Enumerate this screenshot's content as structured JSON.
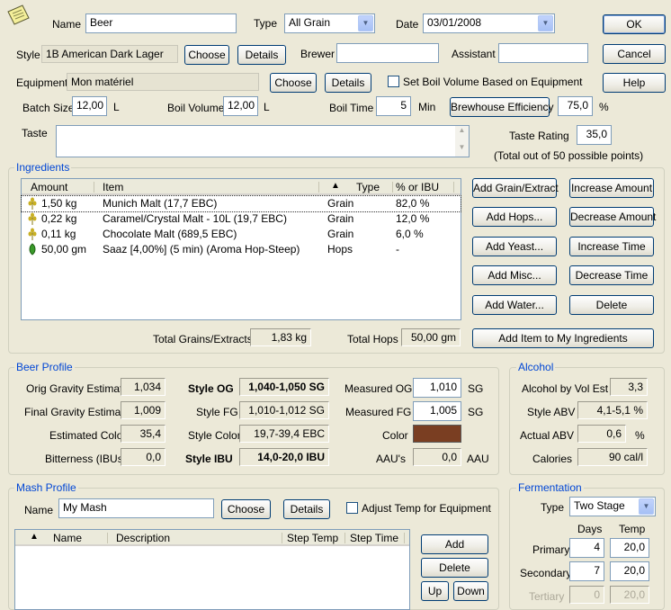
{
  "top": {
    "name_label": "Name",
    "name_value": "Beer",
    "type_label": "Type",
    "type_value": "All Grain",
    "date_label": "Date",
    "date_value": "03/01/2008",
    "style_label": "Style",
    "style_value": "1B American Dark Lager",
    "choose_label": "Choose",
    "details_label": "Details",
    "brewer_label": "Brewer",
    "brewer_value": "",
    "assistant_label": "Assistant",
    "assistant_value": "",
    "equipment_label": "Equipment",
    "equipment_value": "Mon matériel",
    "set_boil_label": "Set Boil Volume Based on Equipment",
    "batch_label": "Batch Size",
    "batch_value": "12,00",
    "batch_unit": "L",
    "boilvol_label": "Boil Volume",
    "boilvol_value": "12,00",
    "boilvol_unit": "L",
    "boiltime_label": "Boil Time",
    "boiltime_value": "5",
    "boiltime_unit": "Min",
    "brewhouse_label": "Brewhouse Efficiency",
    "eff_value": "75,0",
    "eff_unit": "%",
    "taste_label": "Taste",
    "taste_value": "",
    "rating_label": "Taste Rating",
    "rating_value": "35,0",
    "rating_note": "(Total out of 50 possible points)",
    "ok_label": "OK",
    "cancel_label": "Cancel",
    "help_label": "Help"
  },
  "ingredients": {
    "title": "Ingredients",
    "columns": {
      "amount": "Amount",
      "item": "Item",
      "sort": "▲",
      "type": "Type",
      "pct": "% or IBU"
    },
    "rows": [
      {
        "amount": "1,50 kg",
        "item": "Munich Malt (17,7 EBC)",
        "type": "Grain",
        "pct": "82,0 %",
        "icon": "grain-icon"
      },
      {
        "amount": "0,22 kg",
        "item": "Caramel/Crystal Malt - 10L (19,7 EBC)",
        "type": "Grain",
        "pct": "12,0 %",
        "icon": "grain-icon"
      },
      {
        "amount": "0,11 kg",
        "item": "Chocolate Malt (689,5 EBC)",
        "type": "Grain",
        "pct": "6,0 %",
        "icon": "grain-icon"
      },
      {
        "amount": "50,00 gm",
        "item": "Saaz [4,00%]  (5 min) (Aroma Hop-Steep)",
        "type": "Hops",
        "pct": "-",
        "icon": "hop-icon"
      }
    ],
    "buttons": {
      "add_grain": "Add Grain/Extract",
      "add_hops": "Add Hops...",
      "add_yeast": "Add Yeast...",
      "add_misc": "Add Misc...",
      "add_water": "Add Water...",
      "inc_amount": "Increase Amount",
      "dec_amount": "Decrease Amount",
      "inc_time": "Increase Time",
      "dec_time": "Decrease Time",
      "delete": "Delete",
      "add_to_my": "Add Item to My Ingredients"
    },
    "total_grains_label": "Total Grains/Extracts",
    "total_grains_value": "1,83 kg",
    "total_hops_label": "Total Hops",
    "total_hops_value": "50,00 gm"
  },
  "profile": {
    "title": "Beer Profile",
    "og_label": "Orig Gravity Estimate",
    "og_value": "1,034",
    "fg_label": "Final Gravity Estimate",
    "fg_value": "1,009",
    "color_label": "Estimated Color",
    "color_value": "35,4",
    "ibu_label": "Bitterness (IBUs)",
    "ibu_value": "0,0",
    "style_og_label": "Style OG",
    "style_og_value": "1,040-1,050 SG",
    "style_fg_label": "Style FG",
    "style_fg_value": "1,010-1,012 SG",
    "style_color_label": "Style Color",
    "style_color_value": "19,7-39,4 EBC",
    "style_ibu_label": "Style IBU",
    "style_ibu_value": "14,0-20,0 IBU",
    "meas_og_label": "Measured OG",
    "meas_og_value": "1,010",
    "meas_og_unit": "SG",
    "meas_fg_label": "Measured FG",
    "meas_fg_value": "1,005",
    "meas_fg_unit": "SG",
    "color_swatch_label": "Color",
    "swatch_color": "#7a3e22",
    "aau_label": "AAU's",
    "aau_value": "0,0",
    "aau_unit": "AAU"
  },
  "alcohol": {
    "title": "Alcohol",
    "abv_est_label": "Alcohol by Vol Est",
    "abv_est_value": "3,3",
    "style_abv_label": "Style ABV",
    "style_abv_value": "4,1-5,1 %",
    "actual_abv_label": "Actual ABV",
    "actual_abv_value": "0,6",
    "actual_abv_unit": "%",
    "calories_label": "Calories",
    "calories_value": "90 cal/l"
  },
  "mash": {
    "title": "Mash Profile",
    "name_label": "Name",
    "name_value": "My Mash",
    "choose_label": "Choose",
    "details_label": "Details",
    "adjust_label": "Adjust Temp for Equipment",
    "columns": {
      "sort": "▲",
      "name": "Name",
      "desc": "Description",
      "step_temp": "Step Temp",
      "step_time": "Step Time"
    },
    "add_label": "Add",
    "delete_label": "Delete",
    "up_label": "Up",
    "down_label": "Down"
  },
  "fermentation": {
    "title": "Fermentation",
    "type_label": "Type",
    "type_value": "Two Stage",
    "days_label": "Days",
    "temp_label": "Temp",
    "primary_label": "Primary",
    "primary_days": "4",
    "primary_temp": "20,0",
    "secondary_label": "Secondary",
    "secondary_days": "7",
    "secondary_temp": "20,0",
    "tertiary_label": "Tertiary",
    "tertiary_days": "0",
    "tertiary_temp": "20,0"
  }
}
